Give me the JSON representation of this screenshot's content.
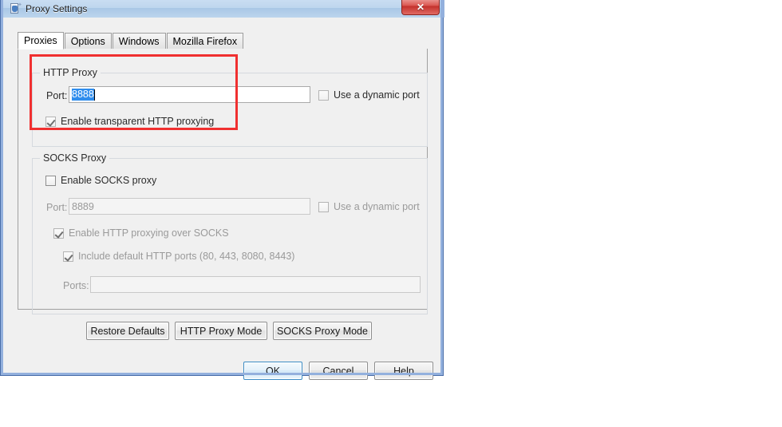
{
  "window": {
    "title": "Proxy Settings",
    "icon": "proxy-settings-icon",
    "close_label": "✕"
  },
  "tabs": [
    {
      "label": "Proxies",
      "active": true
    },
    {
      "label": "Options",
      "active": false
    },
    {
      "label": "Windows",
      "active": false
    },
    {
      "label": "Mozilla Firefox",
      "active": false
    }
  ],
  "http_proxy": {
    "group_title": "HTTP Proxy",
    "port_label": "Port:",
    "port_value": "8888",
    "port_value_selected": true,
    "dynamic_port_label": "Use a dynamic port",
    "dynamic_port_checked": false,
    "dynamic_port_enabled": true,
    "transparent_label": "Enable transparent HTTP proxying",
    "transparent_checked": true,
    "transparent_enabled": true
  },
  "socks_proxy": {
    "group_title": "SOCKS Proxy",
    "enable_label": "Enable SOCKS proxy",
    "enable_checked": false,
    "port_label": "Port:",
    "port_value": "8889",
    "dynamic_port_label": "Use a dynamic port",
    "dynamic_port_checked": false,
    "http_over_socks_label": "Enable HTTP proxying over SOCKS",
    "http_over_socks_checked": true,
    "include_default_label": "Include default HTTP ports (80, 443, 8080, 8443)",
    "include_default_checked": true,
    "ports_label": "Ports:",
    "ports_value": ""
  },
  "mode_buttons": {
    "restore_defaults": "Restore Defaults",
    "http_proxy_mode": "HTTP Proxy Mode",
    "socks_proxy_mode": "SOCKS Proxy Mode"
  },
  "dialog_buttons": {
    "ok": "OK",
    "cancel": "Cancel",
    "help": "Help"
  },
  "annotation": {
    "highlight_color": "#f03030",
    "target": "HTTP Proxy group"
  }
}
